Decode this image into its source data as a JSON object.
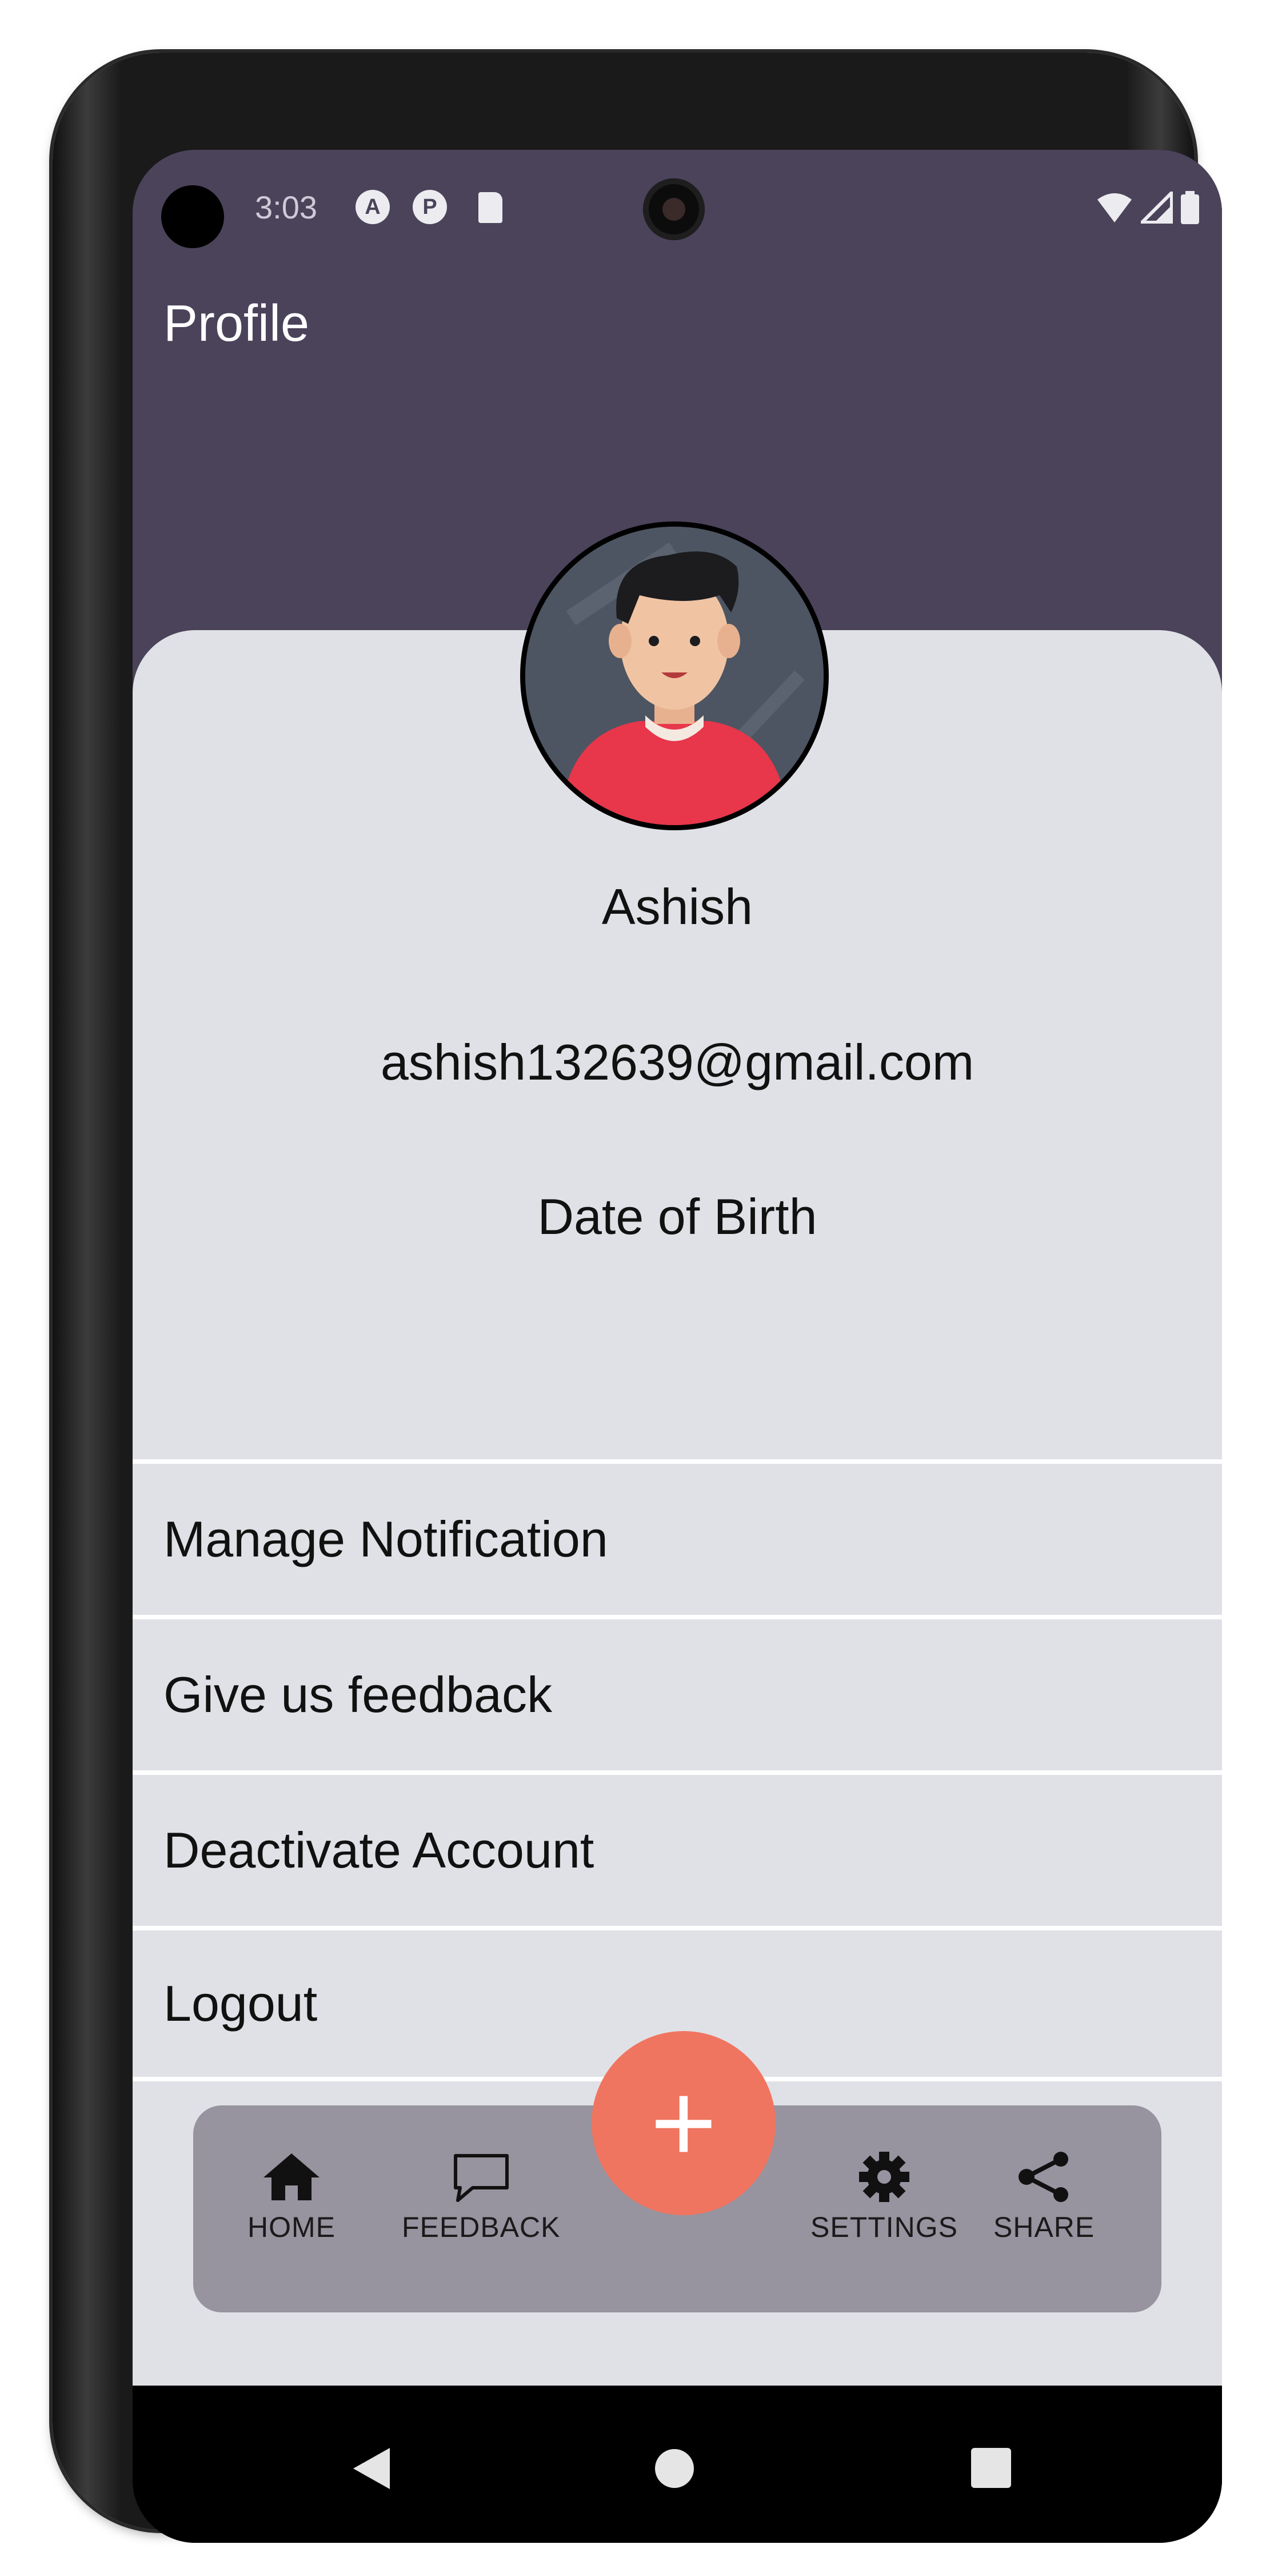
{
  "status_bar": {
    "time": "3:03",
    "icons": [
      "a-icon",
      "p-icon",
      "sd-card-icon",
      "wifi-icon",
      "signal-icon",
      "battery-icon"
    ]
  },
  "header": {
    "title": "Profile",
    "background_color": "#4a435a"
  },
  "profile": {
    "name": "Ashish",
    "email": "ashish132639@gmail.com",
    "dob_label": "Date of Birth"
  },
  "menu": {
    "items": [
      {
        "label": "Manage Notification"
      },
      {
        "label": "Give us feedback"
      },
      {
        "label": "Deactivate Account"
      },
      {
        "label": "Logout"
      }
    ]
  },
  "bottom_nav": {
    "items": [
      {
        "label": "HOME",
        "icon": "home-icon"
      },
      {
        "label": "FEEDBACK",
        "icon": "feedback-icon"
      },
      {
        "label": "SETTINGS",
        "icon": "settings-icon"
      },
      {
        "label": "SHARE",
        "icon": "share-icon"
      }
    ],
    "fab_label": "+",
    "fab_color": "#f07560",
    "bar_color": "#97939f"
  },
  "system_nav": {
    "icons": [
      "back-icon",
      "home-circle-icon",
      "recents-icon"
    ]
  }
}
